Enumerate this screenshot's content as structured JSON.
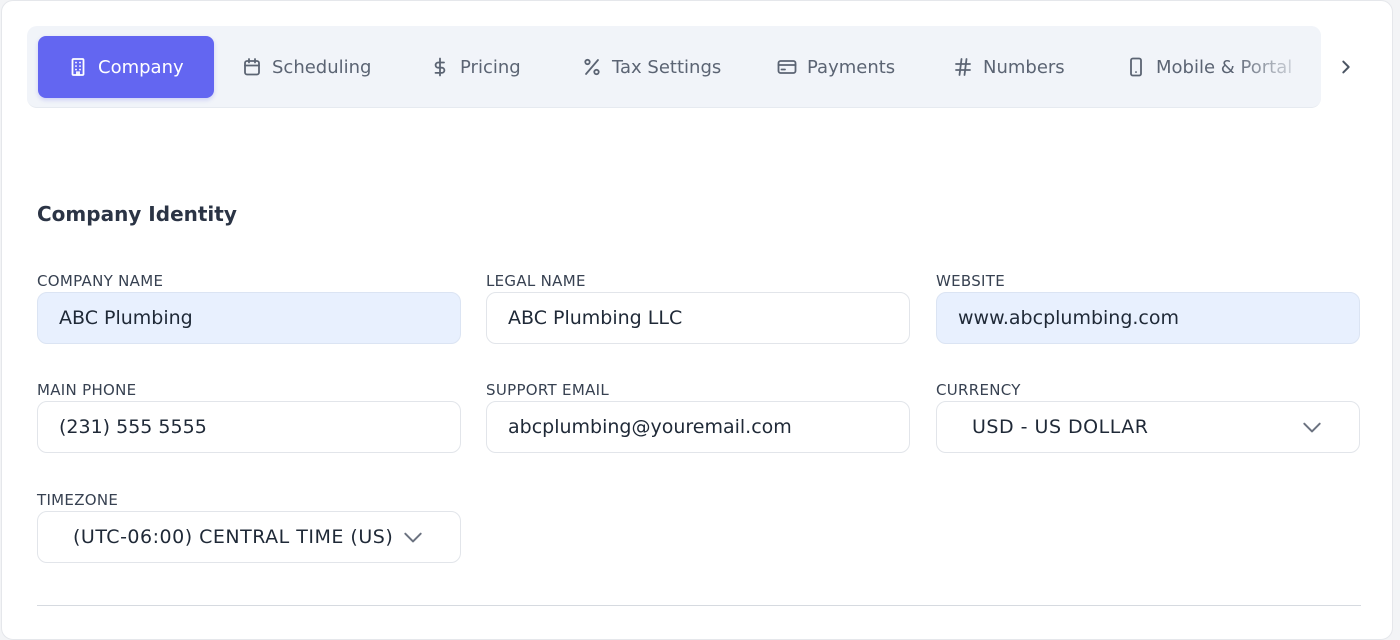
{
  "tabs": [
    {
      "label": "Company",
      "icon": "building-icon",
      "active": true
    },
    {
      "label": "Scheduling",
      "icon": "calendar-icon",
      "active": false
    },
    {
      "label": "Pricing",
      "icon": "dollar-icon",
      "active": false
    },
    {
      "label": "Tax Settings",
      "icon": "percent-icon",
      "active": false
    },
    {
      "label": "Payments",
      "icon": "credit-card-icon",
      "active": false
    },
    {
      "label": "Numbers",
      "icon": "hash-icon",
      "active": false
    },
    {
      "label": "Mobile & Portal",
      "icon": "smartphone-icon",
      "active": false
    }
  ],
  "colors": {
    "accent": "#6366f1",
    "autofill_bg": "#e8f0fe"
  },
  "section": {
    "title": "Company Identity"
  },
  "fields": {
    "company_name": {
      "label": "Company Name",
      "value": "ABC Plumbing"
    },
    "legal_name": {
      "label": "Legal Name",
      "value": "ABC Plumbing LLC"
    },
    "website": {
      "label": "Website",
      "value": "www.abcplumbing.com"
    },
    "main_phone": {
      "label": "Main Phone",
      "value": "(231) 555 5555"
    },
    "support_email": {
      "label": "Support Email",
      "value": "abcplumbing@youremail.com"
    },
    "currency": {
      "label": "Currency",
      "value": "USD - US DOLLAR"
    },
    "timezone": {
      "label": "Timezone",
      "value": "(UTC-06:00) CENTRAL TIME (US)"
    }
  }
}
